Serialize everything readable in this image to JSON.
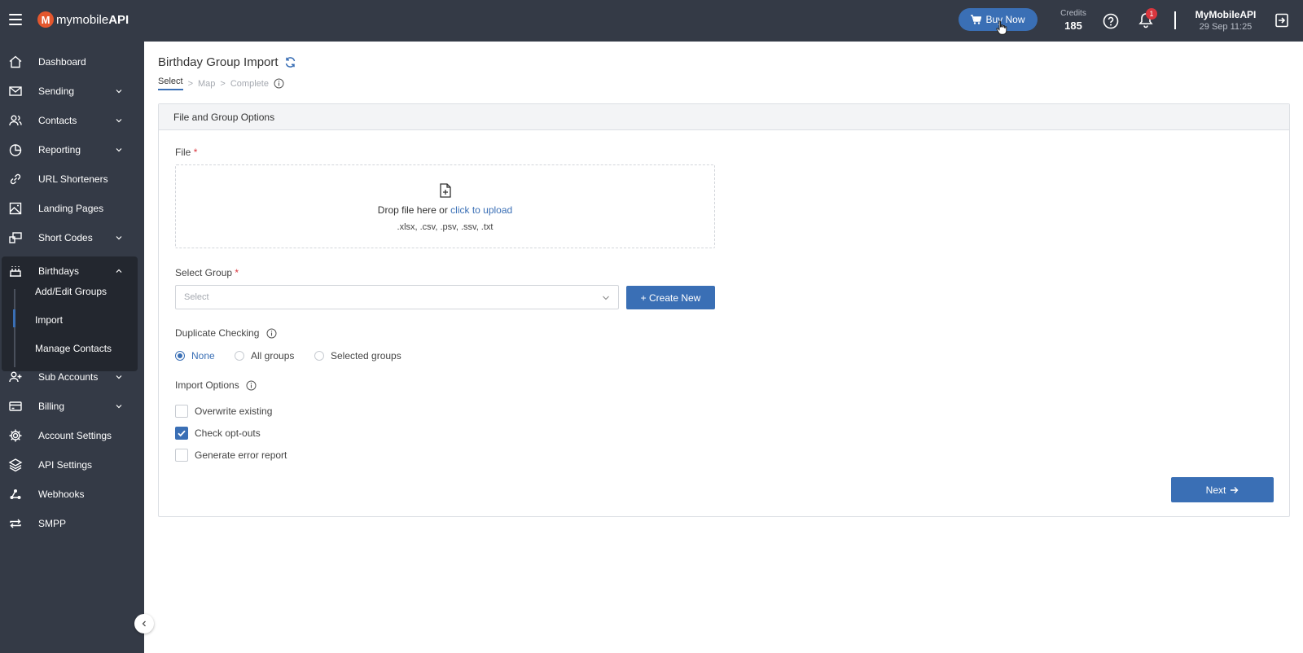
{
  "header": {
    "logo_mark": "M",
    "logo_text_light": "mymobile",
    "logo_text_bold": "API",
    "buy_now_label": "Buy Now",
    "credits_label": "Credits",
    "credits_value": "185",
    "notification_count": "1",
    "user_name": "MyMobileAPI",
    "user_datetime": "29 Sep 11:25"
  },
  "sidebar": {
    "items": [
      {
        "label": "Dashboard",
        "icon": "home-icon"
      },
      {
        "label": "Sending",
        "icon": "mail-icon"
      },
      {
        "label": "Contacts",
        "icon": "contacts-icon"
      },
      {
        "label": "Reporting",
        "icon": "pie-chart-icon"
      },
      {
        "label": "URL Shorteners",
        "icon": "link-icon"
      },
      {
        "label": "Landing Pages",
        "icon": "image-icon"
      },
      {
        "label": "Short Codes",
        "icon": "short-codes-icon"
      },
      {
        "label": "Birthdays",
        "icon": "cake-icon"
      },
      {
        "label": "Sub Accounts",
        "icon": "user-plus-icon"
      },
      {
        "label": "Billing",
        "icon": "credit-card-icon"
      },
      {
        "label": "Account Settings",
        "icon": "gear-icon"
      },
      {
        "label": "API Settings",
        "icon": "layers-icon"
      },
      {
        "label": "Webhooks",
        "icon": "webhook-icon"
      },
      {
        "label": "SMPP",
        "icon": "repeat-icon"
      }
    ],
    "birthday_sub": [
      "Add/Edit Groups",
      "Import",
      "Manage Contacts"
    ]
  },
  "page": {
    "title": "Birthday Group Import",
    "breadcrumb": [
      "Select",
      "Map",
      "Complete"
    ],
    "breadcrumb_sep": ">",
    "card_title": "File and Group Options",
    "file_label": "File",
    "required_mark": "*",
    "drop_text": "Drop file here or ",
    "drop_link": "click to upload",
    "file_types": ".xlsx, .csv, .psv, .ssv, .txt",
    "group_label": "Select Group",
    "group_placeholder": "Select",
    "create_new_label": "+ Create New",
    "duplicate_label": "Duplicate Checking",
    "duplicate_options": [
      "None",
      "All groups",
      "Selected groups"
    ],
    "duplicate_selected": "None",
    "import_label": "Import Options",
    "import_options": [
      {
        "label": "Overwrite existing",
        "checked": false
      },
      {
        "label": "Check opt-outs",
        "checked": true
      },
      {
        "label": "Generate error report",
        "checked": false
      }
    ],
    "next_label": "Next"
  },
  "colors": {
    "accent": "#3a6fb5",
    "sidebar_bg": "#343a46",
    "badge": "#d9363e"
  }
}
